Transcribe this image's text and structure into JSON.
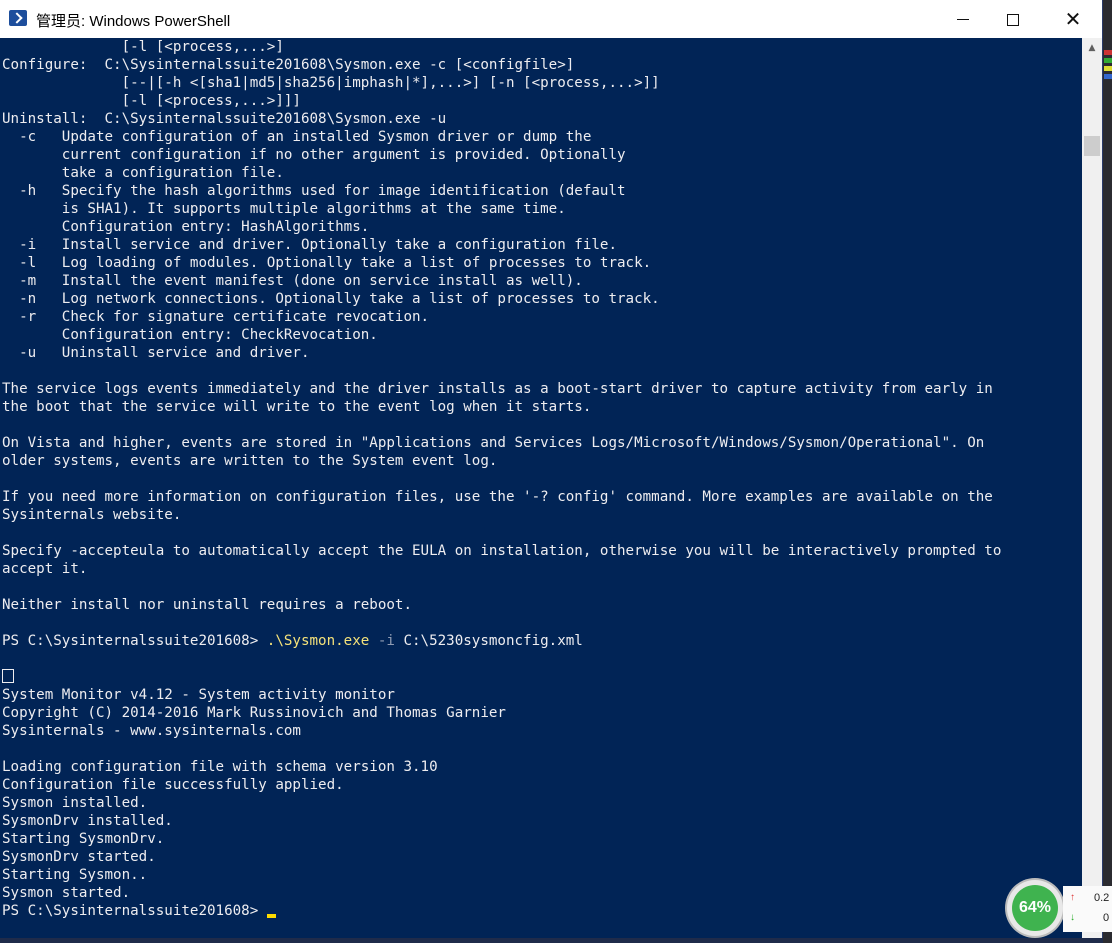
{
  "window": {
    "title": "管理员: Windows PowerShell",
    "minimize_label": "",
    "maximize_label": "",
    "close_label": "✕"
  },
  "console": {
    "lines": [
      "              [-l [<process,...>]",
      "Configure:  C:\\Sysinternalssuite201608\\Sysmon.exe -c [<configfile>]",
      "              [--|[-h <[sha1|md5|sha256|imphash|*],...>] [-n [<process,...>]]",
      "              [-l [<process,...>]]]",
      "Uninstall:  C:\\Sysinternalssuite201608\\Sysmon.exe -u",
      "  -c   Update configuration of an installed Sysmon driver or dump the",
      "       current configuration if no other argument is provided. Optionally",
      "       take a configuration file.",
      "  -h   Specify the hash algorithms used for image identification (default",
      "       is SHA1). It supports multiple algorithms at the same time.",
      "       Configuration entry: HashAlgorithms.",
      "  -i   Install service and driver. Optionally take a configuration file.",
      "  -l   Log loading of modules. Optionally take a list of processes to track.",
      "  -m   Install the event manifest (done on service install as well).",
      "  -n   Log network connections. Optionally take a list of processes to track.",
      "  -r   Check for signature certificate revocation.",
      "       Configuration entry: CheckRevocation.",
      "  -u   Uninstall service and driver.",
      "",
      "The service logs events immediately and the driver installs as a boot-start driver to capture activity from early in",
      "the boot that the service will write to the event log when it starts.",
      "",
      "On Vista and higher, events are stored in \"Applications and Services Logs/Microsoft/Windows/Sysmon/Operational\". On",
      "older systems, events are written to the System event log.",
      "",
      "If you need more information on configuration files, use the '-? config' command. More examples are available on the",
      "Sysinternals website.",
      "",
      "Specify -accepteula to automatically accept the EULA on installation, otherwise you will be interactively prompted to",
      "accept it.",
      "",
      "Neither install nor uninstall requires a reboot.",
      ""
    ],
    "command": {
      "prompt": "PS C:\\Sysinternalssuite201608> ",
      "exe": ".\\Sysmon.exe",
      "flag": " -i",
      "arg": " C:\\5230sysmoncfig.xml"
    },
    "after_lines": [
      "",
      "",
      "System Monitor v4.12 - System activity monitor",
      "Copyright (C) 2014-2016 Mark Russinovich and Thomas Garnier",
      "Sysinternals - www.sysinternals.com",
      "",
      "Loading configuration file with schema version 3.10",
      "Configuration file successfully applied.",
      "Sysmon installed.",
      "SysmonDrv installed.",
      "Starting SysmonDrv.",
      "SysmonDrv started.",
      "Starting Sysmon..",
      "Sysmon started."
    ],
    "final_prompt": "PS C:\\Sysinternalssuite201608> "
  },
  "gadget": {
    "cpu_percent": "64%",
    "net_up": "0.2",
    "net_down": "0",
    "up_arrow": "↑",
    "down_arrow": "↓"
  },
  "colors": {
    "console_bg": "#012456",
    "console_fg": "#eeedf0",
    "exe_color": "#f5e27a",
    "flag_color": "#8f9bb3",
    "cursor": "#fedb00"
  }
}
